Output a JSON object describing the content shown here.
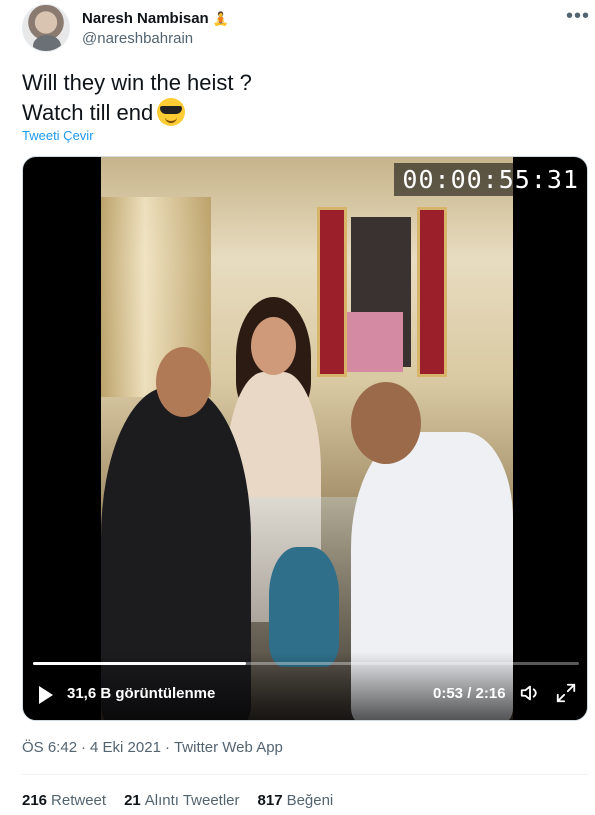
{
  "author": {
    "display_name": "Naresh Nambisan",
    "handle": "@nareshbahrain",
    "name_emoji": "🧘"
  },
  "menu": {
    "more_label": "•••"
  },
  "tweet": {
    "lines": [
      "Will they win the heist ?",
      "Watch till end"
    ],
    "emoji": "sunglasses-face",
    "translate_label": "Tweeti Çevir"
  },
  "video": {
    "timecode_overlay": "00:00:55:31",
    "views_label": "31,6 B görüntülenme",
    "time_display": "0:53 / 2:16",
    "progress": 0.39
  },
  "meta": {
    "time": "ÖS 6:42",
    "date": "4 Eki 2021",
    "source": "Twitter Web App",
    "separator": "·"
  },
  "stats": {
    "retweets": {
      "count": "216",
      "label": "Retweet"
    },
    "quotes": {
      "count": "21",
      "label": "Alıntı Tweetler"
    },
    "likes": {
      "count": "817",
      "label": "Beğeni"
    }
  },
  "colors": {
    "accent": "#1d9bf0",
    "text": "#0f1419",
    "secondary": "#536471"
  }
}
